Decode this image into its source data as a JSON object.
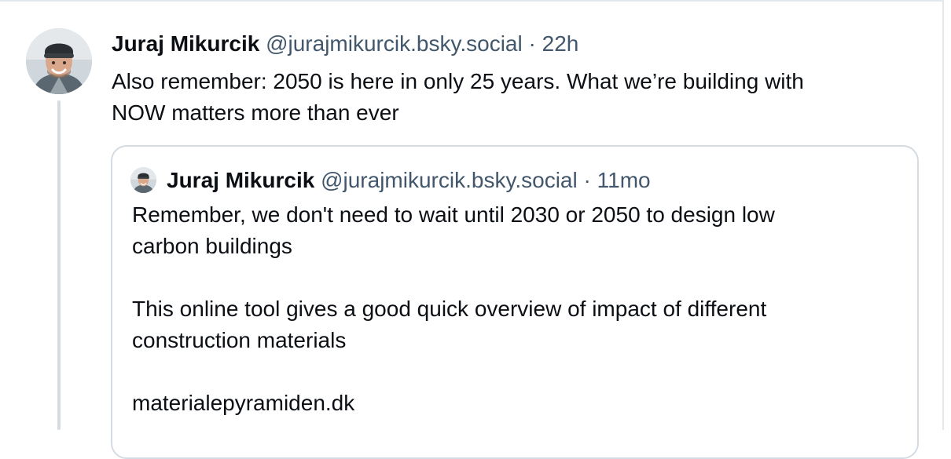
{
  "post": {
    "author_name": "Juraj Mikurcik",
    "handle": "@jurajmikurcik.bsky.social",
    "separator": "·",
    "time": "22h",
    "text": "Also remember: 2050 is here in only 25 years. What we’re building with\nNOW matters more than ever"
  },
  "quote": {
    "author_name": "Juraj Mikurcik",
    "handle": "@jurajmikurcik.bsky.social",
    "separator": "·",
    "time": "11mo",
    "paragraphs": [
      "Remember, we don't need to wait until 2030 or 2050 to design low\ncarbon buildings",
      "This online tool gives a good quick overview of impact of different\nconstruction materials",
      "materialepyramiden.dk"
    ]
  }
}
